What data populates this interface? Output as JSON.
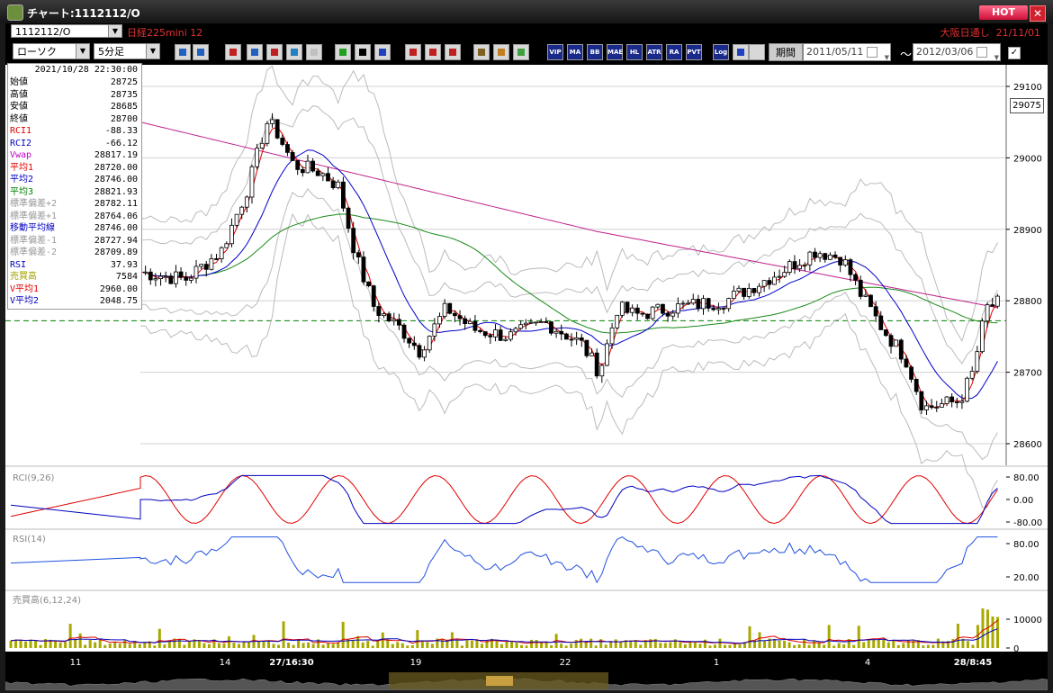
{
  "window": {
    "title": "チャート:1112112/O",
    "hot_label": "HOT",
    "close_label": "✕"
  },
  "symbol_row": {
    "symbol": "1112112/O",
    "name": "日経225mini 12",
    "right_text": "大阪日通し  21/11/01"
  },
  "toolbar": {
    "chart_type": "ローソク",
    "interval": "5分足",
    "period_button": "期間",
    "date_from": "2011/05/11",
    "date_to": "2012/03/06",
    "tilde": "〜",
    "text_buttons": [
      "VIP",
      "MA",
      "BB",
      "MAE",
      "HL",
      "ATR",
      "RA",
      "PVT",
      "Log"
    ]
  },
  "info_panel": {
    "timestamp": "2021/10/28  22:30:00",
    "rows": [
      {
        "label": "始値",
        "value": "28725",
        "color": "#000000"
      },
      {
        "label": "高値",
        "value": "28735",
        "color": "#000000"
      },
      {
        "label": "安値",
        "value": "28685",
        "color": "#000000"
      },
      {
        "label": "終値",
        "value": "28700",
        "color": "#000000"
      },
      {
        "label": "RCI1",
        "value": "-88.33",
        "color": "#e00000"
      },
      {
        "label": "RCI2",
        "value": "-66.12",
        "color": "#0000c0"
      },
      {
        "label": "Vwap",
        "value": "28817.19",
        "color": "#c000c0"
      },
      {
        "label": "平均1",
        "value": "28720.00",
        "color": "#e00000"
      },
      {
        "label": "平均2",
        "value": "28746.00",
        "color": "#0000c0"
      },
      {
        "label": "平均3",
        "value": "28821.93",
        "color": "#008000"
      },
      {
        "label": "標準偏差+2",
        "value": "28782.11",
        "color": "#999999"
      },
      {
        "label": "標準偏差+1",
        "value": "28764.06",
        "color": "#999999"
      },
      {
        "label": "移動平均線",
        "value": "28746.00",
        "color": "#0000c0"
      },
      {
        "label": "標準偏差-1",
        "value": "28727.94",
        "color": "#999999"
      },
      {
        "label": "標準偏差-2",
        "value": "28709.89",
        "color": "#999999"
      },
      {
        "label": "RSI",
        "value": "37.93",
        "color": "#0000c0"
      },
      {
        "label": "売買高",
        "value": "7584",
        "color": "#a0a000"
      },
      {
        "label": "V平均1",
        "value": "2960.00",
        "color": "#e00000"
      },
      {
        "label": "V平均2",
        "value": "2048.75",
        "color": "#0000c0"
      }
    ]
  },
  "price_chart": {
    "y_ticks": [
      "29100",
      "29000",
      "28900",
      "28800",
      "28700",
      "28600"
    ],
    "current_price": "29075"
  },
  "rci_panel": {
    "title": "RCI(9,26)",
    "ticks": [
      "80.00",
      "0.00",
      "-80.00"
    ]
  },
  "rsi_panel": {
    "title": "RSI(14)",
    "ticks": [
      "80.00",
      "20.00"
    ]
  },
  "volume_panel": {
    "title": "売買高(6,12,24)",
    "ticks": [
      "10000",
      "0"
    ]
  },
  "x_axis": {
    "labels": [
      {
        "text": "11",
        "bold": false
      },
      {
        "text": "14",
        "bold": false
      },
      {
        "text": "27/16:30",
        "bold": true
      },
      {
        "text": "19",
        "bold": false
      },
      {
        "text": "22",
        "bold": false
      },
      {
        "text": "1",
        "bold": false
      },
      {
        "text": "4",
        "bold": false
      },
      {
        "text": "28/8:45",
        "bold": true
      }
    ]
  },
  "colors": {
    "up_candle": "#ffffff",
    "down_candle": "#000000",
    "ma1": "#e00000",
    "ma2": "#0000c0",
    "ma3": "#008000",
    "vwap": "#c000c0",
    "band": "#999999",
    "volume": "#a8a800"
  }
}
